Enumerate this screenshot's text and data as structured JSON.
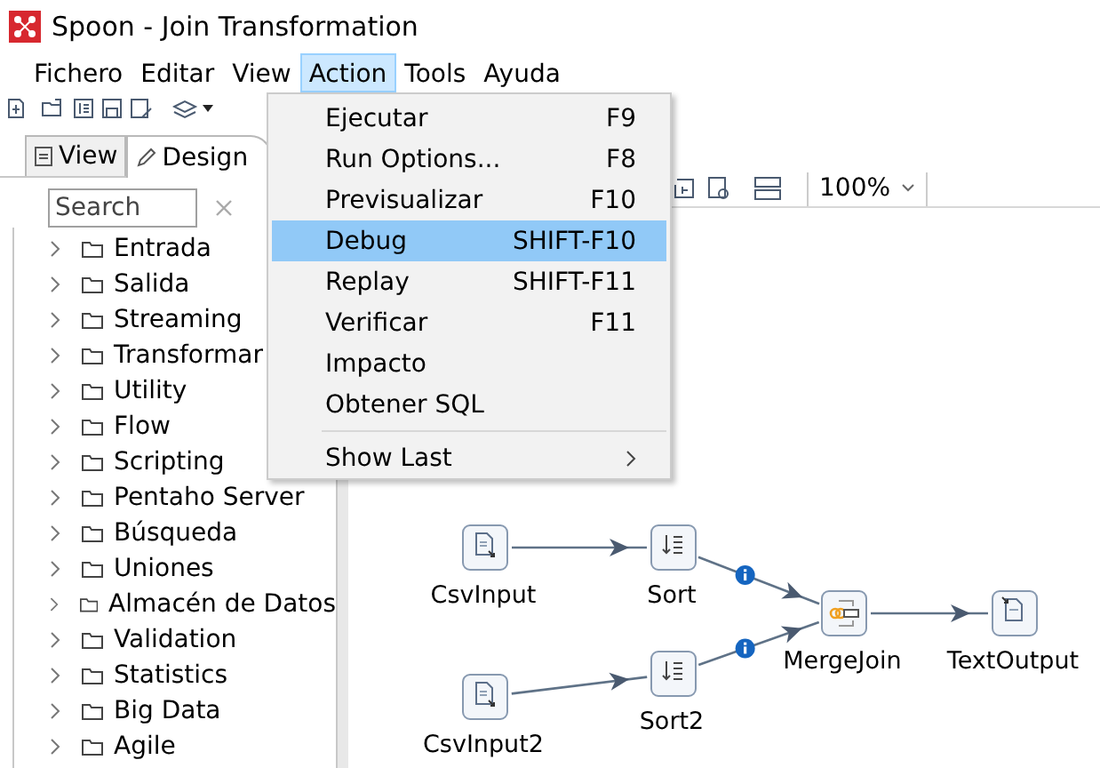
{
  "window": {
    "title": "Spoon - Join Transformation"
  },
  "menubar": [
    {
      "label": "Fichero",
      "selected": false
    },
    {
      "label": "Editar",
      "selected": false
    },
    {
      "label": "View",
      "selected": false
    },
    {
      "label": "Action",
      "selected": true
    },
    {
      "label": "Tools",
      "selected": false
    },
    {
      "label": "Ayuda",
      "selected": false
    }
  ],
  "panel_tabs": [
    {
      "label": "View",
      "selected": false
    },
    {
      "label": "Design",
      "selected": true
    }
  ],
  "search": {
    "placeholder": "Search"
  },
  "tree": [
    {
      "label": "Entrada",
      "expanded": false
    },
    {
      "label": "Salida",
      "expanded": false
    },
    {
      "label": "Streaming",
      "expanded": false
    },
    {
      "label": "Transformar",
      "expanded": false
    },
    {
      "label": "Utility",
      "expanded": false
    },
    {
      "label": "Flow",
      "expanded": false
    },
    {
      "label": "Scripting",
      "expanded": false
    },
    {
      "label": "Pentaho Server",
      "expanded": false
    },
    {
      "label": "Búsqueda",
      "expanded": false
    },
    {
      "label": "Uniones",
      "expanded": false
    },
    {
      "label": "Almacén de Datos",
      "expanded": false
    },
    {
      "label": "Validation",
      "expanded": false
    },
    {
      "label": "Statistics",
      "expanded": false
    },
    {
      "label": "Big Data",
      "expanded": false
    },
    {
      "label": "Agile",
      "expanded": false
    }
  ],
  "action_menu": [
    {
      "label": "Ejecutar",
      "shortcut": "F9",
      "selected": false
    },
    {
      "label": "Run Options...",
      "shortcut": "F8",
      "selected": false
    },
    {
      "label": "Previsualizar",
      "shortcut": "F10",
      "selected": false
    },
    {
      "label": "Debug",
      "shortcut": "SHIFT-F10",
      "selected": true
    },
    {
      "label": "Replay",
      "shortcut": "SHIFT-F11",
      "selected": false
    },
    {
      "label": "Verificar",
      "shortcut": "F11",
      "selected": false
    },
    {
      "label": "Impacto",
      "selected": false
    },
    {
      "label": "Obtener SQL",
      "selected": false
    },
    {
      "label": "Show Last",
      "selected": false,
      "submenu": true,
      "separator_before": true
    }
  ],
  "zoom": {
    "value": "100%"
  },
  "canvas": {
    "steps": [
      {
        "label": "CsvInput",
        "kind": "csv_input"
      },
      {
        "label": "Sort",
        "kind": "sort"
      },
      {
        "label": "MergeJoin",
        "kind": "merge_join"
      },
      {
        "label": "TextOutput",
        "kind": "text_output"
      },
      {
        "label": "CsvInput2",
        "kind": "csv_input"
      },
      {
        "label": "Sort2",
        "kind": "sort"
      }
    ],
    "hops": [
      {
        "info": false
      },
      {
        "info": true
      },
      {
        "info": true
      },
      {
        "info": false
      },
      {
        "info": false
      }
    ]
  }
}
